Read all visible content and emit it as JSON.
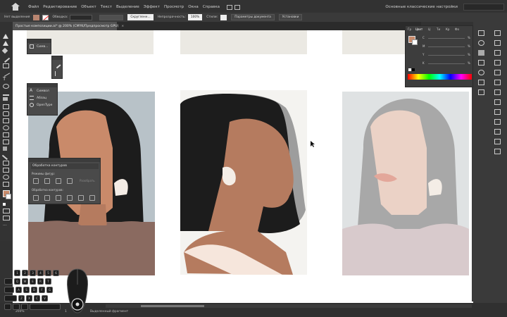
{
  "menubar": {
    "items": [
      "Файл",
      "Редактирование",
      "Объект",
      "Текст",
      "Выделение",
      "Эффект",
      "Просмотр",
      "Окна",
      "Справка"
    ],
    "workspace": "Основные классические настройки"
  },
  "controlbar": {
    "selection_label": "Нет выделения",
    "stroke_label": "Обводка:",
    "brush_label": "Скругленн...",
    "opacity_label": "Непрозрачность:",
    "opacity_value": "100%",
    "styles_label": "Стили:",
    "doc_settings_button": "Параметры документа",
    "preferences_button": "Установки"
  },
  "document": {
    "tab_title": "Простые композиции.ai* @ 200% (CMYK/Предпросмотр GPU)"
  },
  "panels": {
    "symbols": {
      "items": [
        "Симв..."
      ]
    },
    "glyphs": {
      "items": [
        "Символ",
        "Абзац",
        "OpenType"
      ]
    },
    "pathfinder": {
      "title": "Обработка контуров",
      "shape_modes_label": "Режимы фигур:",
      "expand_button": "Разобрать",
      "pathfinders_label": "Обработка контуров:"
    },
    "color": {
      "tabs": [
        "Гр",
        "Цвет",
        "Ц",
        "Ти",
        "Кр",
        "Фо"
      ],
      "rows": [
        {
          "channel": "C",
          "unit": "%"
        },
        {
          "channel": "M",
          "unit": "%"
        },
        {
          "channel": "Y",
          "unit": "%"
        },
        {
          "channel": "K",
          "unit": "%"
        }
      ]
    }
  },
  "statusbar": {
    "zoom": "200%",
    "page": "1",
    "tool_hint": "Выделенный фрагмент"
  },
  "keyboard": {
    "keys": [
      "1",
      "2",
      "3",
      "4",
      "5",
      "6",
      "Q",
      "W",
      "E",
      "R",
      "T",
      "A",
      "S",
      "D",
      "F",
      "G",
      "Z",
      "X",
      "C",
      "V"
    ]
  },
  "colors": {
    "skin_dark": "#c98a6a",
    "skin_mid": "#b57b5f",
    "skin_light": "#e9cbbd",
    "hair": "#1c1c1c",
    "shirt_brown": "#8a6a60",
    "bg_blue": "#b8c2c8",
    "bg_light": "#f4f3f0",
    "bg_grey": "#dfe2e3"
  }
}
